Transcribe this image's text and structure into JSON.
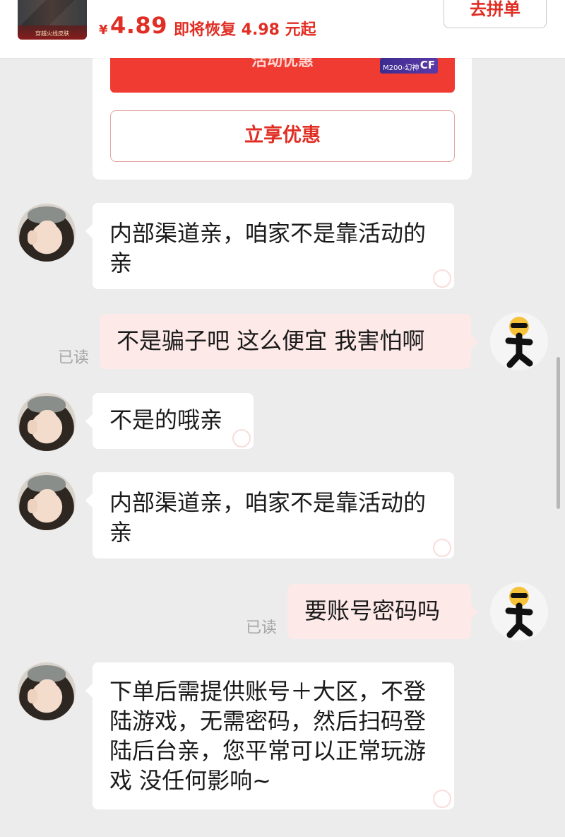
{
  "product": {
    "thumbnail_label": "穿越火线皮肤",
    "price_symbol": "¥",
    "price": "4.89",
    "restore_note": "即将恢复 4.98 元起",
    "group_button": "去拼单"
  },
  "promo": {
    "banner_label": "活动优惠",
    "badge_left": "M200-幻神",
    "badge_right": "CF",
    "claim_button": "立享优惠"
  },
  "messages": [
    {
      "side": "left",
      "text": "内部渠道亲，咱家不是靠活动的亲"
    },
    {
      "side": "right",
      "text": "不是骗子吧 这么便宜 我害怕啊",
      "status": "已读"
    },
    {
      "side": "left",
      "text": "不是的哦亲"
    },
    {
      "side": "left",
      "text": "内部渠道亲，咱家不是靠活动的亲"
    },
    {
      "side": "right",
      "text": "要账号密码吗",
      "status": "已读"
    },
    {
      "side": "left",
      "text": "下单后需提供账号＋大区，不登陆游戏，无需密码，然后扫码登陆后台亲，您平常可以正常玩游戏 没任何影响~"
    }
  ],
  "colors": {
    "accent": "#e02e24",
    "chat_bg": "#ececec",
    "own_bubble": "#fde9e8"
  }
}
